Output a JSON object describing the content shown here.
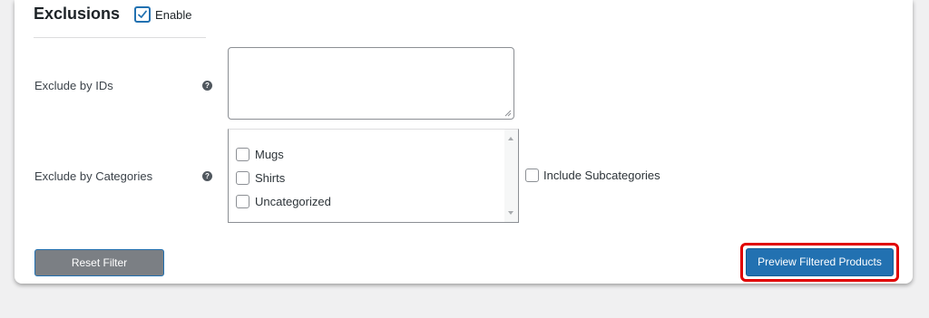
{
  "exclusions": {
    "title": "Exclusions",
    "enable_label": "Enable",
    "enable_checked": true
  },
  "ids_row": {
    "label": "Exclude by IDs",
    "help_icon": "question-circle-icon",
    "value": ""
  },
  "categories_row": {
    "label": "Exclude by Categories",
    "help_icon": "question-circle-icon",
    "items": [
      {
        "label": "Mugs",
        "checked": false
      },
      {
        "label": "Shirts",
        "checked": false
      },
      {
        "label": "Uncategorized",
        "checked": false
      }
    ],
    "include_subcategories_label": "Include Subcategories",
    "include_subcategories_checked": false
  },
  "buttons": {
    "reset_label": "Reset Filter",
    "preview_label": "Preview Filtered Products"
  },
  "colors": {
    "accent": "#2271b1",
    "reset_bg": "#7b7f84",
    "highlight": "#e00000"
  }
}
